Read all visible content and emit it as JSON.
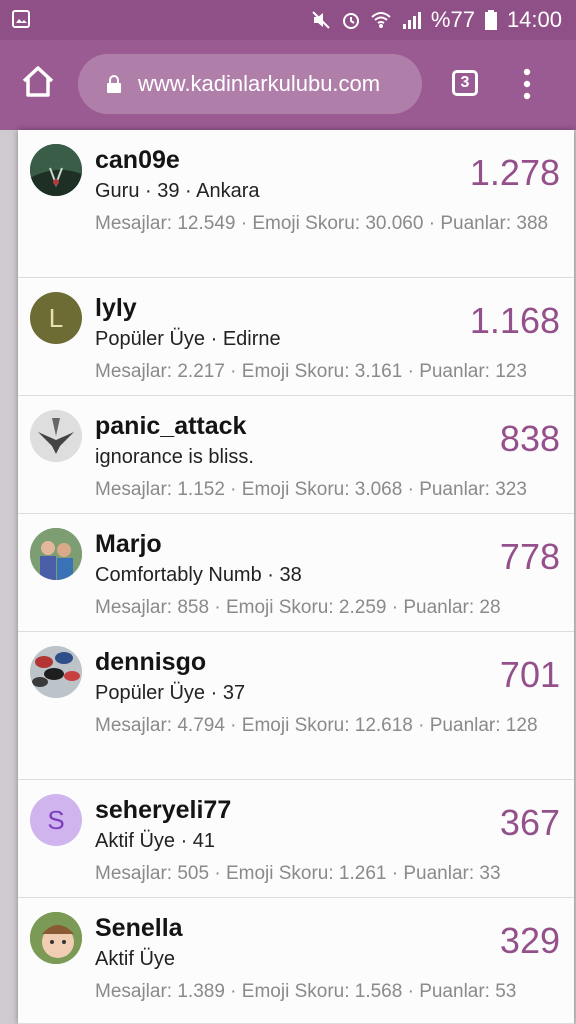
{
  "status_bar": {
    "battery": "%77",
    "time": "14:00",
    "icons": [
      "image-icon",
      "mute-icon",
      "alarm-icon",
      "wifi-icon",
      "signal-icon",
      "battery-icon"
    ]
  },
  "browser": {
    "url": "www.kadinlarkulubu.com",
    "tab_count": "3"
  },
  "members": [
    {
      "name": "can09e",
      "title": "Guru · 39 · Ankara",
      "stats": "Mesajlar: 12.549 · Emoji Skoru: 30.060 · Puanlar: 388",
      "score": "1.278",
      "avatar_letter": ""
    },
    {
      "name": "lyly",
      "title": "Popüler Üye · Edirne",
      "stats": "Mesajlar: 2.217 · Emoji Skoru: 3.161 · Puanlar: 123",
      "score": "1.168",
      "avatar_letter": "L"
    },
    {
      "name": "panic_attack",
      "title": "ignorance is bliss.",
      "stats": "Mesajlar: 1.152 · Emoji Skoru: 3.068 · Puanlar: 323",
      "score": "838",
      "avatar_letter": ""
    },
    {
      "name": "Marjo",
      "title": "Comfortably Numb · 38",
      "stats": "Mesajlar: 858 · Emoji Skoru: 2.259 · Puanlar: 28",
      "score": "778",
      "avatar_letter": ""
    },
    {
      "name": "dennisgo",
      "title": "Popüler Üye · 37",
      "stats": "Mesajlar: 4.794 · Emoji Skoru: 12.618 · Puanlar: 128",
      "score": "701",
      "avatar_letter": ""
    },
    {
      "name": "seheryeli77",
      "title": "Aktif Üye · 41",
      "stats": "Mesajlar: 505 · Emoji Skoru: 1.261 · Puanlar: 33",
      "score": "367",
      "avatar_letter": "S"
    },
    {
      "name": "Senella",
      "title": "Aktif Üye",
      "stats": "Mesajlar: 1.389 · Emoji Skoru: 1.568 · Puanlar: 53",
      "score": "329",
      "avatar_letter": ""
    }
  ],
  "colors": {
    "status_bar": "#8f4f87",
    "browser_bar": "#9a5a92",
    "score": "#94508a"
  }
}
